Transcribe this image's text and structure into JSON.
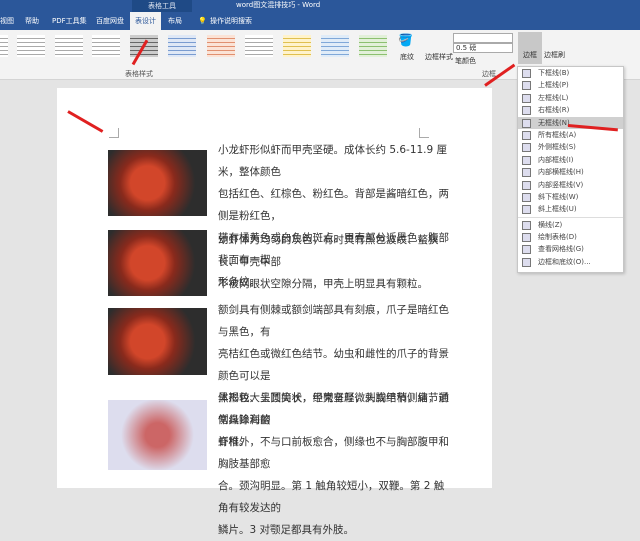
{
  "titlebar": {
    "context": "表格工具",
    "title": "word图文混排技巧 - Word"
  },
  "tabs": [
    {
      "label": "视图"
    },
    {
      "label": "帮助"
    },
    {
      "label": "PDF工具集"
    },
    {
      "label": "百度网盘"
    },
    {
      "label": "表设计",
      "active": true
    },
    {
      "label": "布局"
    },
    {
      "label": "操作说明搜索",
      "icon": "lightbulb-icon"
    }
  ],
  "ribbon": {
    "table_styles_group": "表格样式",
    "shading": "底纹",
    "border_styles": "边框样式",
    "line_weight": "0.5 磅",
    "pen_color": "笔颜色",
    "borders": "边框",
    "border_painter": "边框刷",
    "borders_group": "边框"
  },
  "menu": [
    {
      "label": "下框线(B)"
    },
    {
      "label": "上框线(P)"
    },
    {
      "label": "左框线(L)"
    },
    {
      "label": "右框线(R)"
    },
    {
      "label": "无框线(N)",
      "highlight": true
    },
    {
      "label": "所有框线(A)"
    },
    {
      "label": "外侧框线(S)"
    },
    {
      "label": "内部框线(I)"
    },
    {
      "label": "内部横框线(H)"
    },
    {
      "label": "内部竖框线(V)"
    },
    {
      "label": "斜下框线(W)"
    },
    {
      "label": "斜上框线(U)"
    },
    {
      "label": "横线(Z)"
    },
    {
      "label": "绘制表格(D)"
    },
    {
      "label": "查看网格线(G)"
    },
    {
      "label": "边框和底纹(O)..."
    }
  ],
  "paragraphs": [
    {
      "lines": [
        "小龙虾形似虾而甲壳坚硬。成体长约 5.6-11.9 厘米，整体颜色",
        "包括红色、红棕色、粉红色。背部是酱暗红色，两侧是粉红色，",
        "带有橘黄色或白色的斑点。甲壳部分近黑色，腹部背面有一楔",
        "形条纹。"
      ]
    },
    {
      "lines": [
        "幼虾体为均匀的灰色，有时具有黑色波纹、螯狭长、甲壳中部",
        "不被网眼状空隙分隔，甲壳上明显具有颗粒。"
      ]
    },
    {
      "lines": [
        "额剑具有侧棘或额剑端部具有刻痕，爪子是暗红色与黑色，有",
        "亮桔红色或微红色结节。幼虫和雌性的爪子的背景颜色可以是",
        "黑褐色、头顶尖长，经常有轻微刺或结节，结节通常具锋利的",
        "脊椎。"
      ]
    },
    {
      "lines": [
        "体形较大呈圆筒状，甲壳坚厚，头胸甲稍侧扁，前侧缘除海螯",
        "虾科外，不与口前板愈合，侧缘也不与胸部腹甲和胸肢基部愈",
        "合。颈沟明显。第 1 触角较短小，双鞭。第 2 触角有较发达的",
        "鳞片。3 对颚足都具有外肢。"
      ]
    }
  ],
  "colors": {
    "accent": "#2b579a",
    "arrow": "#e02020"
  }
}
